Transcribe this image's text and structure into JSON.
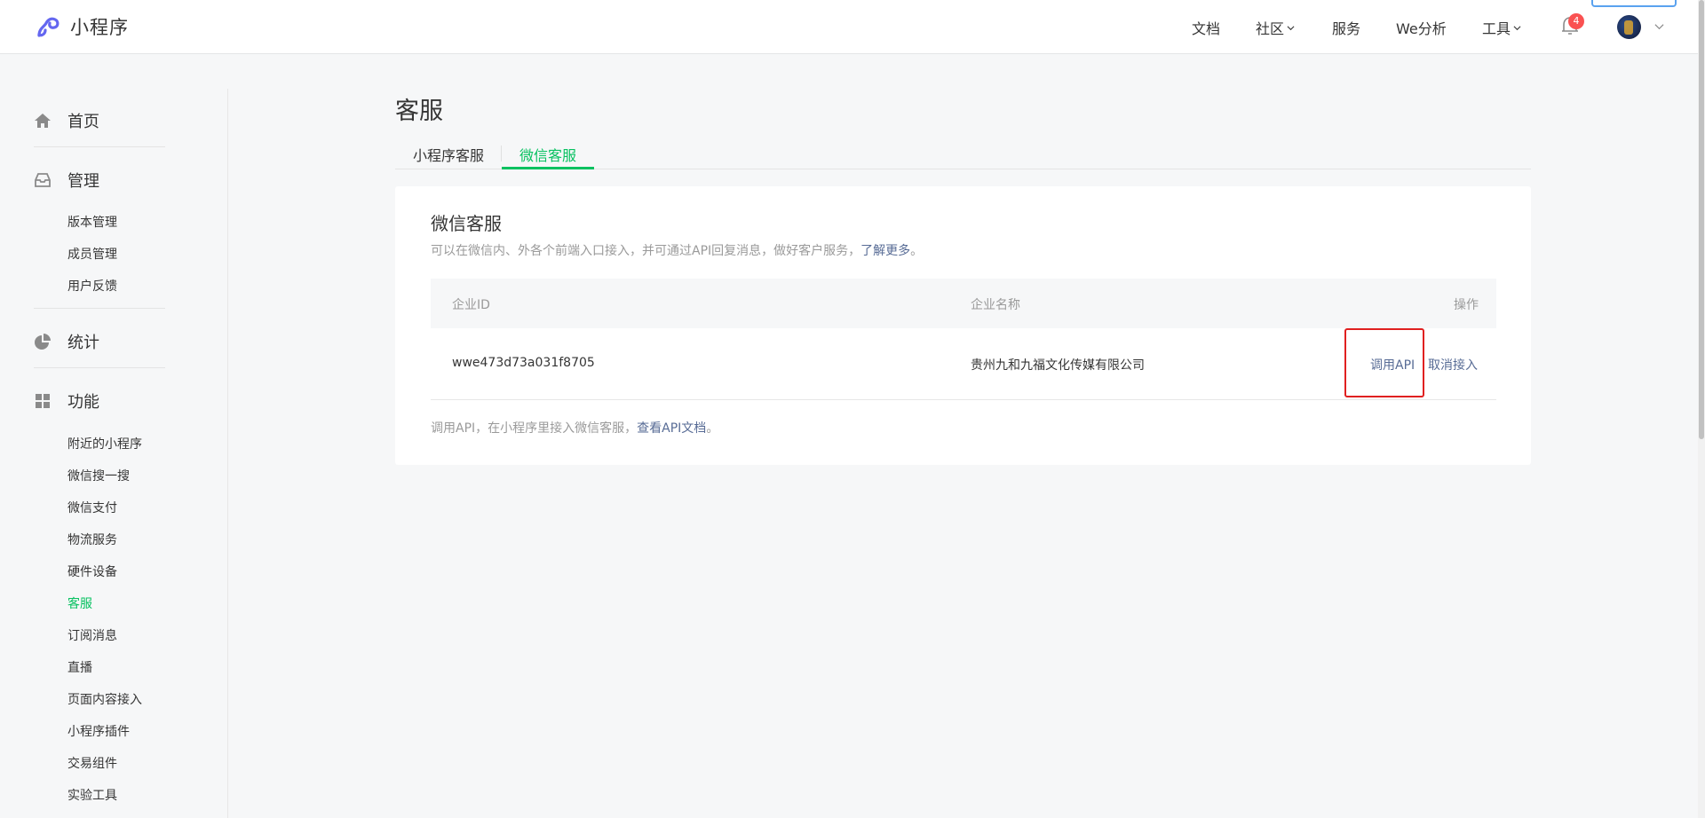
{
  "header": {
    "app_name": "小程序",
    "nav": [
      {
        "label": "文档",
        "has_dropdown": false
      },
      {
        "label": "社区",
        "has_dropdown": true
      },
      {
        "label": "服务",
        "has_dropdown": false
      },
      {
        "label": "We分析",
        "has_dropdown": false
      },
      {
        "label": "工具",
        "has_dropdown": true
      }
    ],
    "notification_count": "4",
    "accent_color": "#07c160",
    "badge_color": "#fa5151"
  },
  "sidebar": {
    "sections": [
      {
        "label": "首页",
        "icon": "home-icon"
      },
      {
        "label": "管理",
        "icon": "inbox-icon",
        "items": [
          "版本管理",
          "成员管理",
          "用户反馈"
        ]
      },
      {
        "label": "统计",
        "icon": "pie-chart-icon"
      },
      {
        "label": "功能",
        "icon": "grid-icon",
        "items": [
          "附近的小程序",
          "微信搜一搜",
          "微信支付",
          "物流服务",
          "硬件设备",
          "客服",
          "订阅消息",
          "直播",
          "页面内容接入",
          "小程序插件",
          "交易组件",
          "实验工具"
        ]
      }
    ],
    "active_item": "客服"
  },
  "main": {
    "title": "客服",
    "tabs": [
      {
        "label": "小程序客服",
        "active": false
      },
      {
        "label": "微信客服",
        "active": true
      }
    ],
    "card": {
      "title": "微信客服",
      "desc": "可以在微信内、外各个前端入口接入，并可通过API回复消息，做好客户服务，",
      "desc_link": "了解更多",
      "desc_end": "。",
      "columns": {
        "id": "企业ID",
        "name": "企业名称",
        "op": "操作"
      },
      "rows": [
        {
          "id": "wwe473d73a031f8705",
          "name": "贵州九和九福文化传媒有限公司",
          "op_api": "调用API",
          "op_cancel": "取消接入"
        }
      ],
      "footer": "调用API，在小程序里接入微信客服，",
      "footer_link": "查看API文档",
      "footer_end": "。"
    }
  }
}
